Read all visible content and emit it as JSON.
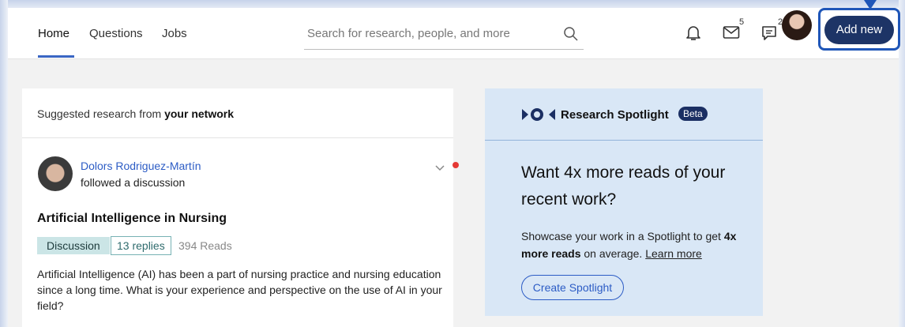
{
  "nav": {
    "home": "Home",
    "questions": "Questions",
    "jobs": "Jobs",
    "search_placeholder": "Search for research, people, and more",
    "mail_count": "5",
    "chat_count": "2",
    "add_new": "Add new"
  },
  "feed": {
    "header_prefix": "Suggested research from ",
    "header_bold": "your network",
    "author_name": "Dolors Rodriguez-Martín",
    "author_action": "followed a discussion",
    "title": "Artificial Intelligence in Nursing",
    "tag": "Discussion",
    "replies": "13 replies",
    "reads": "394 Reads",
    "body": "Artificial Intelligence (AI) has been a part of nursing practice and nursing education since a long time. What is your experience and perspective on the use of AI in your field?"
  },
  "spotlight": {
    "title": "Research Spotlight",
    "badge": "Beta",
    "heading": "Want 4x more reads of your recent work?",
    "text_prefix": "Showcase your work in a Spotlight to get ",
    "text_bold": "4x more reads",
    "text_suffix": " on average. ",
    "learn_more": "Learn more",
    "button": "Create Spotlight"
  },
  "colors": {
    "accent": "#2c5cc5",
    "add_button": "#1d3466",
    "highlight": "#1f56b8",
    "spotlight_bg": "#d9e7f6"
  }
}
